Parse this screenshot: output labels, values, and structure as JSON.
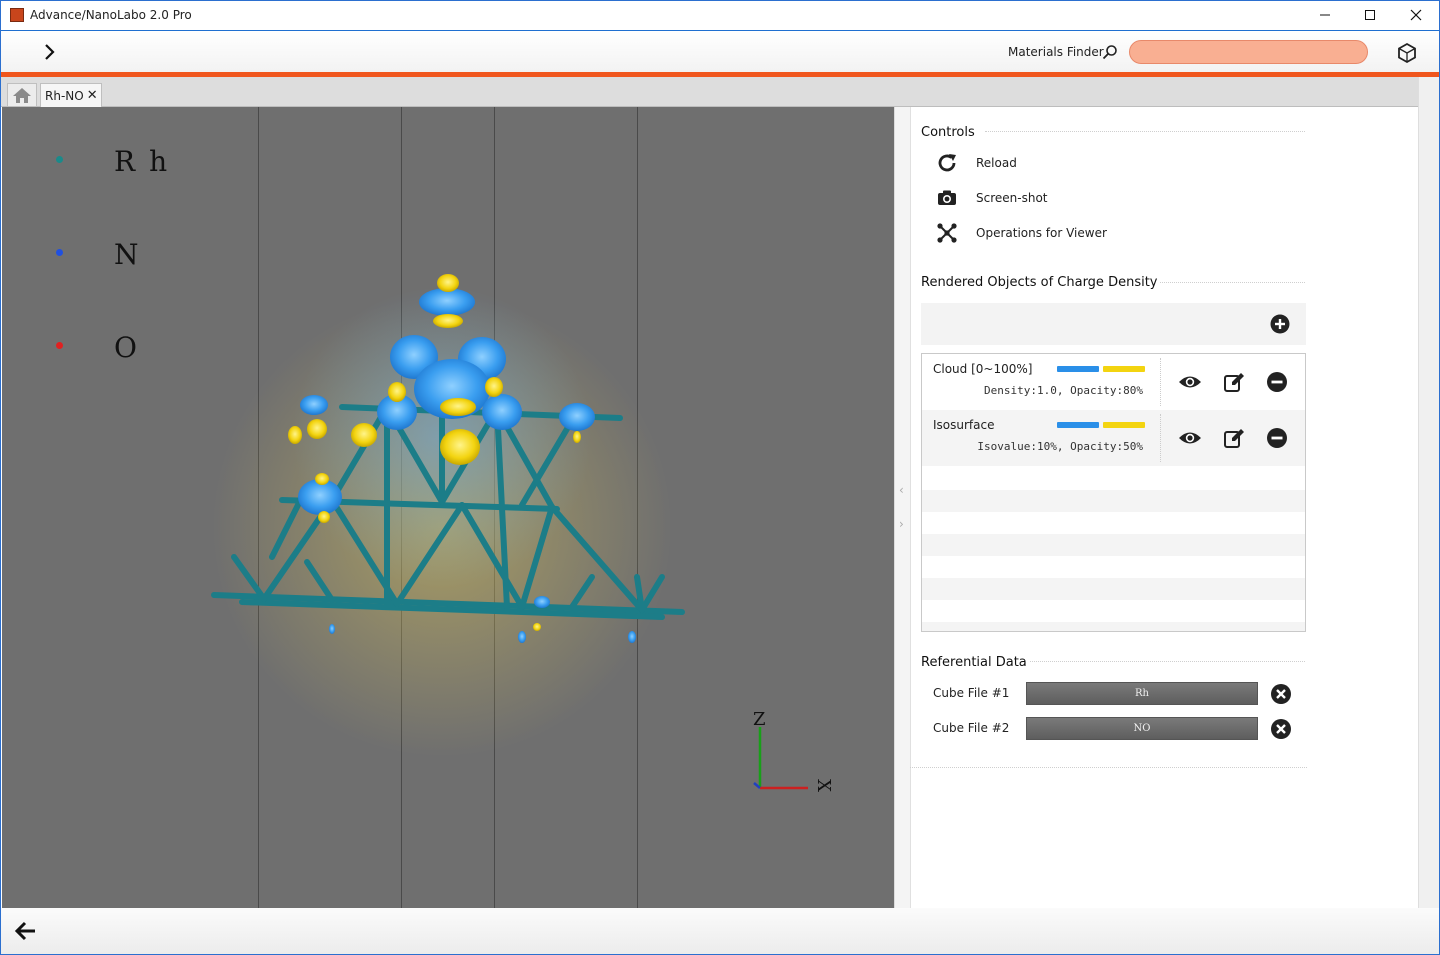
{
  "window": {
    "title": "Advance/NanoLabo 2.0 Pro",
    "minimize": "─",
    "maximize": "☐",
    "close": "✕"
  },
  "toolbar": {
    "expand_icon": "chevron-right-icon",
    "materials_finder_label": "Materials Finder",
    "search_value": "",
    "search_placeholder": "",
    "accent_color": "#f0561d"
  },
  "tabs": [
    {
      "name": "home",
      "icon": "home-icon"
    },
    {
      "name": "Rh-NO",
      "close": "✕"
    }
  ],
  "viewer": {
    "background": "#6f6f6f",
    "legend": [
      {
        "element": "Rh",
        "color": "#1a8a8a"
      },
      {
        "element": "N",
        "color": "#2050e0"
      },
      {
        "element": "O",
        "color": "#e02020"
      }
    ],
    "axes": {
      "z_label": "Z",
      "x_label": "X"
    }
  },
  "panel": {
    "controls": {
      "title": "Controls",
      "items": [
        {
          "label": "Reload",
          "icon": "reload-icon"
        },
        {
          "label": "Screen-shot",
          "icon": "camera-icon"
        },
        {
          "label": "Operations for Viewer",
          "icon": "operations-icon"
        }
      ]
    },
    "rendered_objects": {
      "title": "Rendered Objects of Charge Density",
      "add_icon": "plus-circle-icon",
      "rows": [
        {
          "name": "Cloud [0~100%]",
          "detail": "Density:1.0, Opacity:80%",
          "color_neg": "#2a8fe8",
          "color_pos": "#f3d410"
        },
        {
          "name": "Isosurface",
          "detail": "Isovalue:10%, Opacity:50%",
          "color_neg": "#2a8fe8",
          "color_pos": "#f3d410"
        }
      ]
    },
    "referential": {
      "title": "Referential Data",
      "items": [
        {
          "label": "Cube File #1",
          "value": "Rh"
        },
        {
          "label": "Cube File #2",
          "value": "NO"
        }
      ]
    }
  },
  "bottombar": {
    "back_icon": "arrow-left-icon"
  }
}
